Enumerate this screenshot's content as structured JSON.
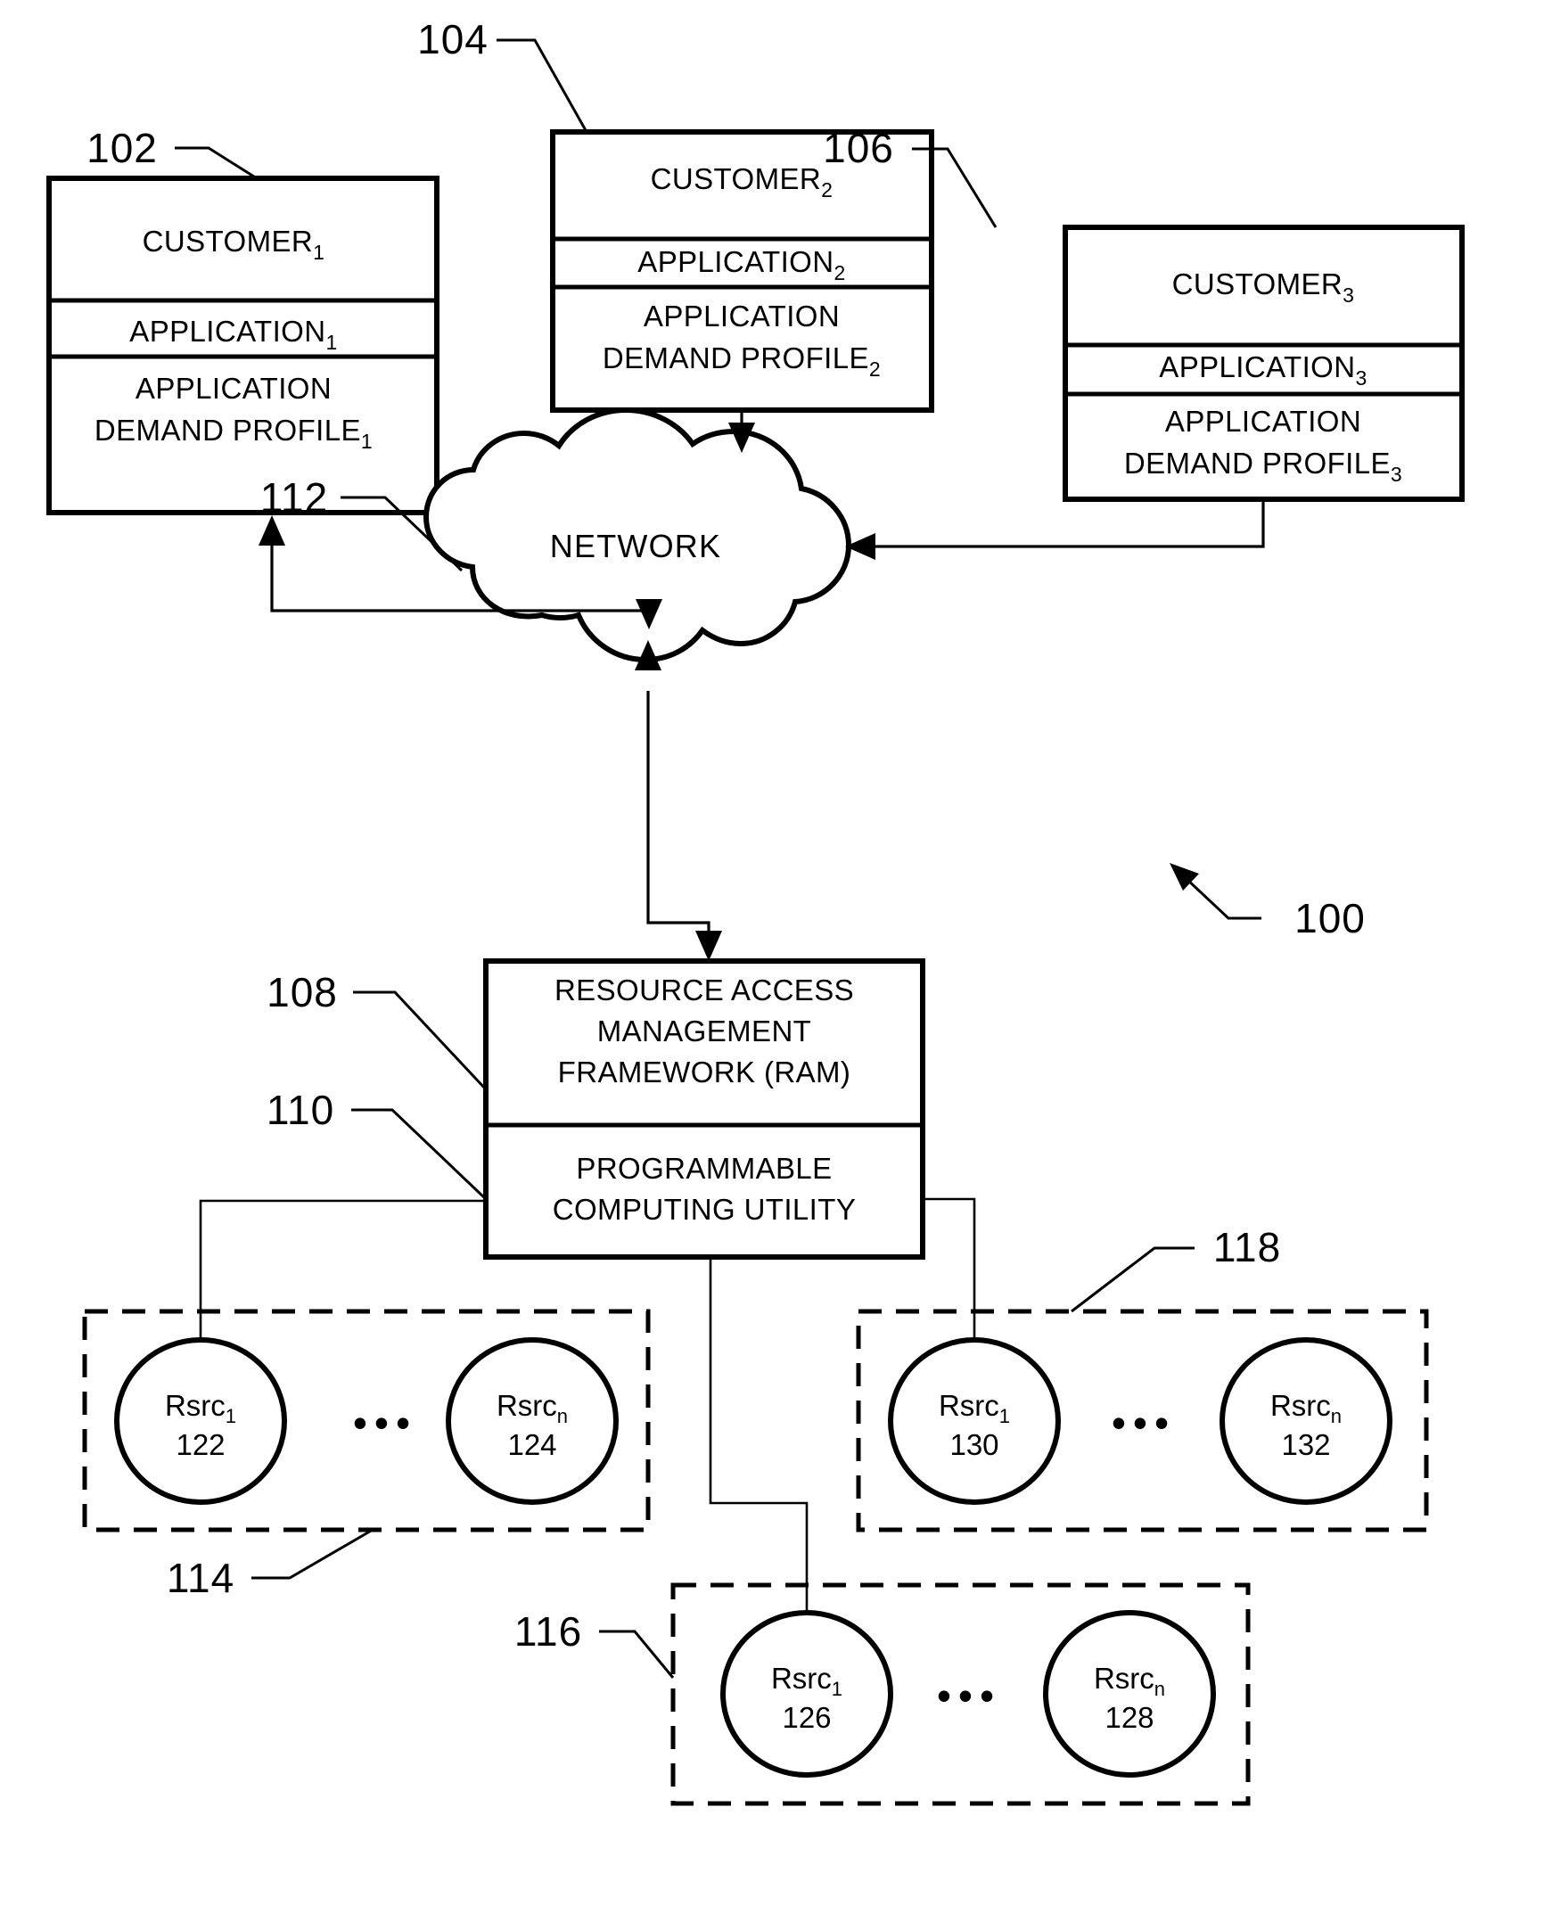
{
  "figure": {
    "type": "patent-system-diagram",
    "overall_ref": "100"
  },
  "customers": [
    {
      "ref": "102",
      "title": "CUSTOMER",
      "title_sub": "1",
      "application": "APPLICATION",
      "application_sub": "1",
      "profile_line1": "APPLICATION",
      "profile_line2": "DEMAND PROFILE",
      "profile_sub": "1"
    },
    {
      "ref": "104",
      "title": "CUSTOMER",
      "title_sub": "2",
      "application": "APPLICATION",
      "application_sub": "2",
      "profile_line1": "APPLICATION",
      "profile_line2": "DEMAND PROFILE",
      "profile_sub": "2"
    },
    {
      "ref": "106",
      "title": "CUSTOMER",
      "title_sub": "3",
      "application": "APPLICATION",
      "application_sub": "3",
      "profile_line1": "APPLICATION",
      "profile_line2": "DEMAND PROFILE",
      "profile_sub": "3"
    }
  ],
  "network": {
    "ref": "112",
    "label": "NETWORK"
  },
  "framework": {
    "ref": "108",
    "line1": "RESOURCE ACCESS",
    "line2": "MANAGEMENT",
    "line3": "FRAMEWORK (RAM)"
  },
  "utility": {
    "ref": "110",
    "line1": "PROGRAMMABLE",
    "line2": "COMPUTING UTILITY"
  },
  "resource_groups": [
    {
      "ref": "114",
      "resources": [
        {
          "name": "Rsrc",
          "sub": "1",
          "ref": "122"
        },
        {
          "name": "Rsrc",
          "sub": "n",
          "ref": "124"
        }
      ],
      "ellipsis": "•••"
    },
    {
      "ref": "118",
      "resources": [
        {
          "name": "Rsrc",
          "sub": "1",
          "ref": "130"
        },
        {
          "name": "Rsrc",
          "sub": "n",
          "ref": "132"
        }
      ],
      "ellipsis": "•••"
    },
    {
      "ref": "116",
      "resources": [
        {
          "name": "Rsrc",
          "sub": "1",
          "ref": "126"
        },
        {
          "name": "Rsrc",
          "sub": "n",
          "ref": "128"
        }
      ],
      "ellipsis": "•••"
    }
  ],
  "colors": {
    "ink": "#000000",
    "paper": "#ffffff"
  }
}
